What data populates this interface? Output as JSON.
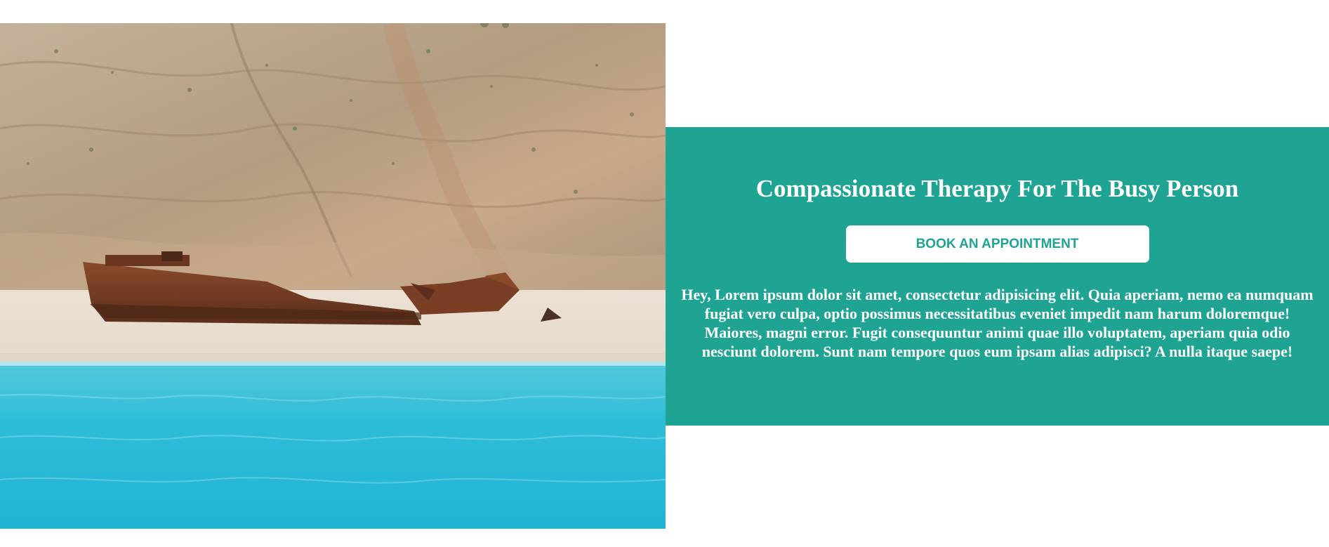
{
  "hero": {
    "image_description_icon": "beach-shipwreck-photo"
  },
  "panel": {
    "title": "Compassionate Therapy For The Busy Person",
    "button_label": "BOOK AN APPOINTMENT",
    "body": "Hey, Lorem ipsum dolor sit amet, consectetur adipisicing elit. Quia aperiam, nemo ea numquam fugiat vero culpa, optio possimus necessitatibus eveniet impedit nam harum doloremque! Maiores, magni error. Fugit consequuntur animi quae illo voluptatem, aperiam quia odio nesciunt dolorem. Sunt nam tempore quos eum ipsam alias adipisci? A nulla itaque saepe!"
  },
  "colors": {
    "accent": "#1fa393",
    "button_bg": "#ffffff",
    "text_on_accent": "#ffffff"
  }
}
